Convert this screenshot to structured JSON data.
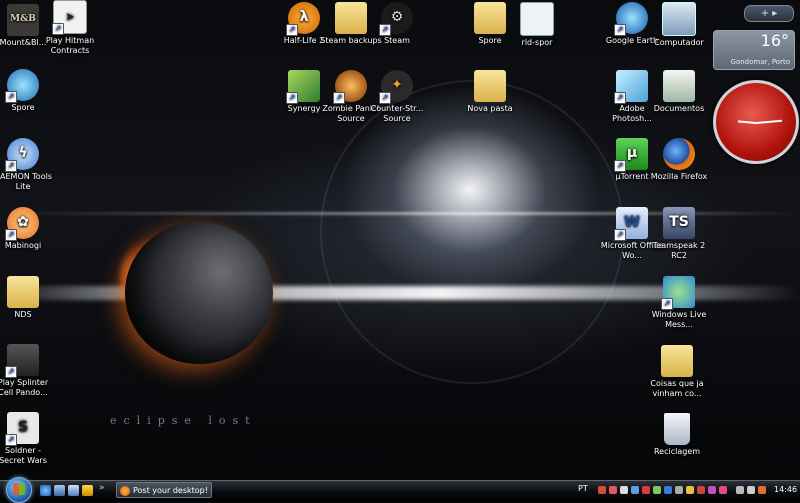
{
  "wallpaper": {
    "caption": "eclipse lost"
  },
  "desktop_icons": {
    "mountblade": "Mount&Bl...",
    "hitman": "Play Hitman Contracts",
    "spore_left": "Spore",
    "daemon": "DAEMON Tools Lite",
    "mabinogi": "Mabinogi",
    "nds": "NDS",
    "splinter": "Play Splinter Cell Pando...",
    "soldner": "Soldner - Secret Wars",
    "halflife": "Half-Life 2",
    "steam_backups": "Steam backups",
    "steam": "Steam",
    "spore_top": "Spore",
    "rld": "rld-spor",
    "synergy": "Synergy",
    "zombie": "Zombie Panic! Source",
    "counter": "Counter-Str... Source",
    "nova_pasta": "Nova pasta",
    "google_earth": "Google Earth",
    "computador": "Computador",
    "photoshop": "Adobe Photosh...",
    "documentos": "Documentos",
    "utorrent": "µTorrent",
    "firefox": "Mozilla Firefox",
    "office": "Microsoft Office Wo...",
    "teamspeak": "Teamspeak 2 RC2",
    "live_messenger": "Windows Live Mess...",
    "coisas": "Coisas que ja vinham co...",
    "reciclagem": "Reciclagem"
  },
  "icon_glyphs": {
    "mountblade": "M&B",
    "halflife": "λ",
    "utorrent": "µ",
    "teamspeak": "TS",
    "office": "W",
    "soldner": "S"
  },
  "gadgets": {
    "sidebar_controls": "+ ▸",
    "weather_temp": "16°",
    "weather_location": "Gondomar, Porto"
  },
  "taskbar": {
    "task_button": "Post your desktop! -...",
    "overflow": "»",
    "language": "PT",
    "time": "14:46"
  },
  "colors": {
    "accent": "#2a6fbd",
    "clock_face": "#b0140c"
  }
}
